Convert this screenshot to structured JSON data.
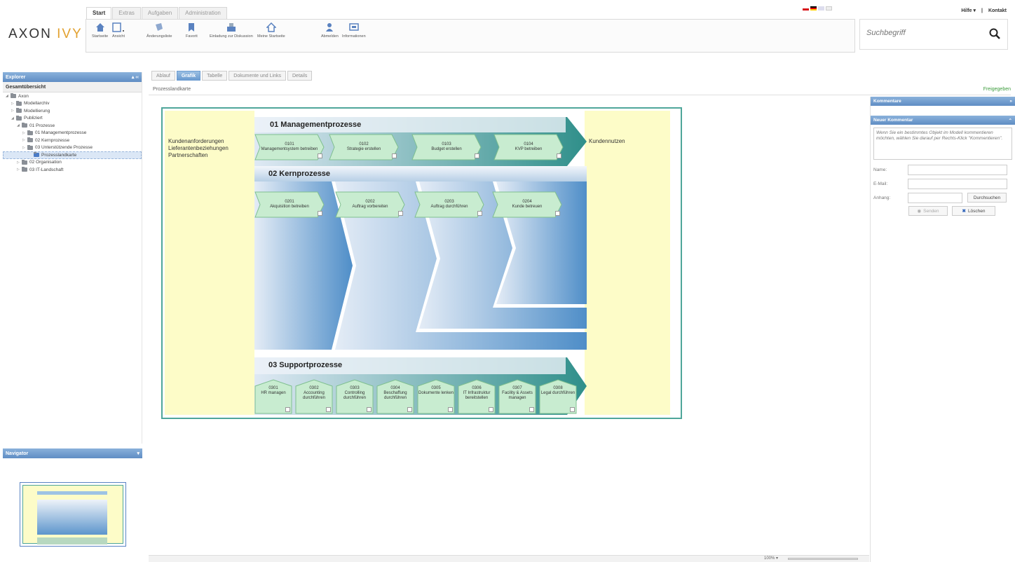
{
  "app": {
    "logo_main": "AXON ",
    "logo_accent": "IVY"
  },
  "menu_tabs": [
    "Start",
    "Extras",
    "Aufgaben",
    "Administration"
  ],
  "toolbar": [
    "Startseite",
    "Ansicht",
    "Änderungsliste",
    "Favorit",
    "Einladung zur Diskussion",
    "Meine Startseite",
    "Abmelden",
    "Informationen"
  ],
  "top_links": {
    "help": "Hilfe ▾",
    "sep": "|",
    "contact": "Kontakt"
  },
  "search": {
    "placeholder": "Suchbegriff"
  },
  "explorer": {
    "title": "Explorer",
    "overview": "Gesamtübersicht",
    "tree": [
      {
        "label": "Axon",
        "indent": 0,
        "tri": "◢"
      },
      {
        "label": "Modellarchiv",
        "indent": 1,
        "tri": "▷"
      },
      {
        "label": "Modellierung",
        "indent": 1,
        "tri": "▷"
      },
      {
        "label": "Publiziert",
        "indent": 1,
        "tri": "◢"
      },
      {
        "label": "01 Prozesse",
        "indent": 2,
        "tri": "◢"
      },
      {
        "label": "01 Managementprozesse",
        "indent": 3,
        "tri": "▷"
      },
      {
        "label": "02 Kernprozesse",
        "indent": 3,
        "tri": "▷"
      },
      {
        "label": "03 Unterstützende Prozesse",
        "indent": 3,
        "tri": "▷"
      },
      {
        "label": "Prozesslandkarte",
        "indent": 4,
        "tri": "",
        "selected": true
      },
      {
        "label": "02 Organisation",
        "indent": 2,
        "tri": "▷"
      },
      {
        "label": "03 IT-Landschaft",
        "indent": 2,
        "tri": "▷"
      }
    ]
  },
  "navigator": {
    "title": "Navigator"
  },
  "content_tabs": [
    "Ablauf",
    "Grafik",
    "Tabelle",
    "Dokumente und Links",
    "Details"
  ],
  "breadcrumb": "Prozesslandkarte",
  "status": "Freigegeben",
  "diagram": {
    "left_text": [
      "Kundenanforderungen",
      "Lieferantenbeziehungen",
      "Partnerschaften"
    ],
    "right_text": "Kundennutzen",
    "mgmt_title": "01 Managementprozesse",
    "mgmt": [
      {
        "code": "0101",
        "label": "Managementsystem betreiben"
      },
      {
        "code": "0102",
        "label": "Strategie erstellen"
      },
      {
        "code": "0103",
        "label": "Budget erstellen"
      },
      {
        "code": "0104",
        "label": "KVP betreiben"
      }
    ],
    "core_title": "02 Kernprozesse",
    "core": [
      {
        "code": "0201",
        "label": "Akquisition betreiben"
      },
      {
        "code": "0202",
        "label": "Auftrag vorbereiten"
      },
      {
        "code": "0203",
        "label": "Auftrag durchführen"
      },
      {
        "code": "0204",
        "label": "Kunde betreuen"
      }
    ],
    "support_title": "03 Supportprozesse",
    "support": [
      {
        "code": "0301",
        "label": "HR managen"
      },
      {
        "code": "0302",
        "label": "Accounting durchführen"
      },
      {
        "code": "0303",
        "label": "Controlling durchführen"
      },
      {
        "code": "0304",
        "label": "Beschaffung durchführen"
      },
      {
        "code": "0305",
        "label": "Dokumente lenken"
      },
      {
        "code": "0306",
        "label": "IT Infrastruktur bereitstellen"
      },
      {
        "code": "0307",
        "label": "Facility & Assets managen"
      },
      {
        "code": "0308",
        "label": "Legal durchführen"
      }
    ]
  },
  "zoom": "100% ▾",
  "comments": {
    "title": "Kommentare",
    "new_title": "Neuer Kommentar",
    "hint": "Wenn Sie ein bestimmtes Objekt im Modell kommentieren möchten, wählen Sie darauf per Rechts-Klick \"Kommentieren\".",
    "name_label": "Name:",
    "email_label": "E-Mail:",
    "attach_label": "Anhang:",
    "browse": "Durchsuchen",
    "send": "Senden",
    "delete": "Löschen"
  },
  "colors": {
    "accent": "#e2a12f",
    "panel": "#6b9bd0",
    "frame": "#4fa69a",
    "approved": "#3b9b3b"
  }
}
